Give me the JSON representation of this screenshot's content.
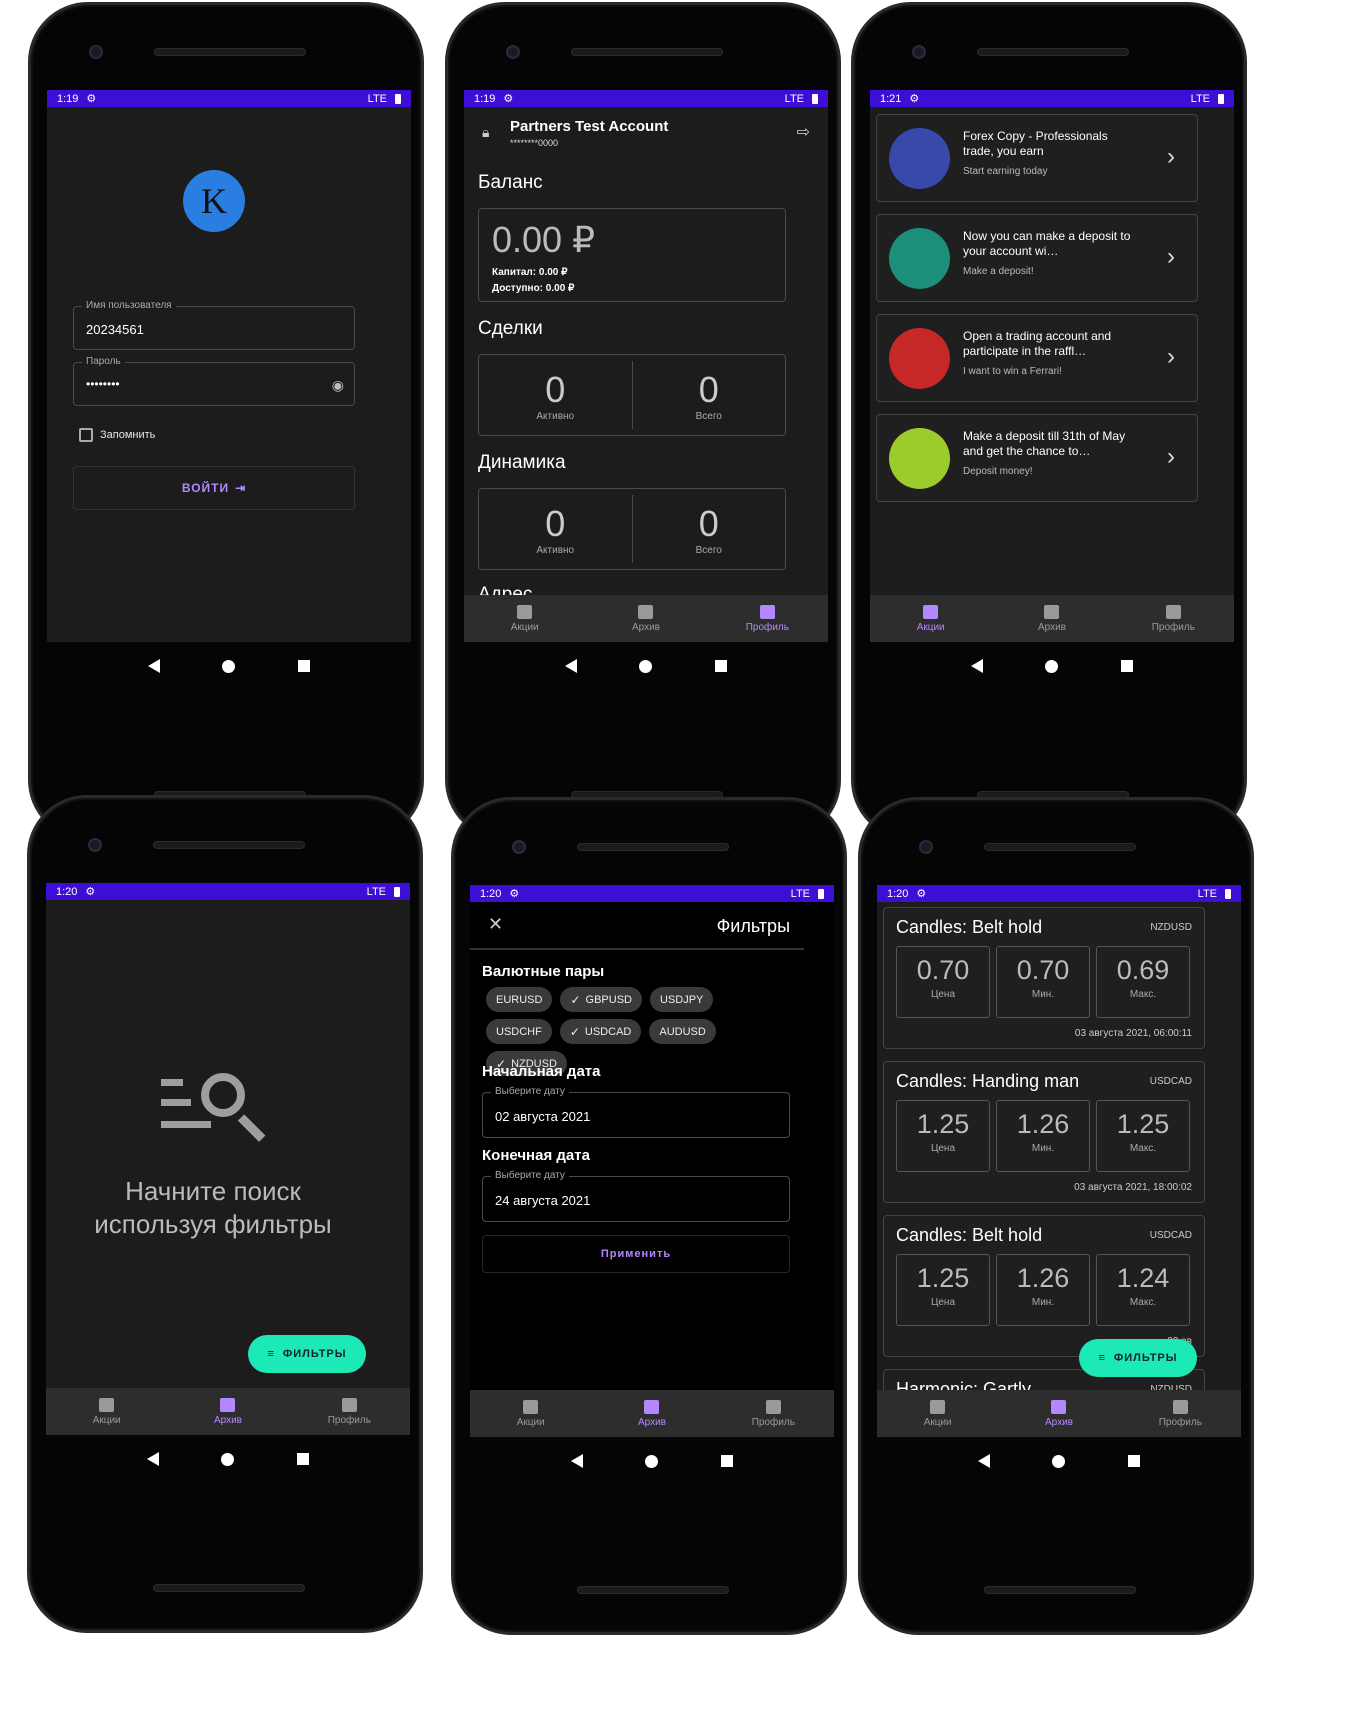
{
  "phones": [
    {
      "status_time": "1:19",
      "status_right": "LTE"
    },
    {
      "status_time": "1:19",
      "status_right": "LTE"
    },
    {
      "status_time": "1:21",
      "status_right": "LTE"
    },
    {
      "status_time": "1:20",
      "status_right": "LTE"
    },
    {
      "status_time": "1:20",
      "status_right": "LTE"
    },
    {
      "status_time": "1:20",
      "status_right": "LTE"
    }
  ],
  "nav": {
    "promo": "Акции",
    "archive": "Архив",
    "profile": "Профиль"
  },
  "login": {
    "avatar_letter": "K",
    "username_label": "Имя пользователя",
    "username_value": "20234561",
    "password_label": "Пароль",
    "password_value": "••••••••",
    "remember_label": "Запомнить",
    "login_button": "ВОЙТИ"
  },
  "profile": {
    "account_name": "Partners Test Account",
    "account_number": "********0000",
    "balance_title": "Баланс",
    "balance_value": "0.00 ₽",
    "capital": "Капитал: 0.00 ₽",
    "available": "Доступно: 0.00 ₽",
    "deals_title": "Сделки",
    "deals_active_value": "0",
    "deals_active_label": "Активно",
    "deals_total_value": "0",
    "deals_total_label": "Всего",
    "dynamics_title": "Динамика",
    "dyn_active_value": "0",
    "dyn_active_label": "Активно",
    "dyn_total_value": "0",
    "dyn_total_label": "Всего",
    "address_title": "Адрес"
  },
  "promos": [
    {
      "title": "Forex Copy - Professionals trade, you earn",
      "subtitle": "Start earning today",
      "color": "#3949ab"
    },
    {
      "title": "Now you can make a deposit to your account wi…",
      "subtitle": "Make a deposit!",
      "color": "#1b8f7a"
    },
    {
      "title": "Open a trading account and participate in the raffl…",
      "subtitle": "I want to win a Ferrari!",
      "color": "#c62828"
    },
    {
      "title": "Make a deposit till 31th of May and get the chance to…",
      "subtitle": "Deposit money!",
      "color": "#9ccc2b"
    }
  ],
  "empty": {
    "message": "Начните поиск используя фильтры",
    "fab": "ФИЛЬТРЫ"
  },
  "filters": {
    "title": "Фильтры",
    "pairs_title": "Валютные пары",
    "pairs": [
      {
        "label": "EURUSD",
        "checked": false
      },
      {
        "label": "GBPUSD",
        "checked": true
      },
      {
        "label": "USDJPY",
        "checked": false
      },
      {
        "label": "USDCHF",
        "checked": false
      },
      {
        "label": "USDCAD",
        "checked": true
      },
      {
        "label": "AUDUSD",
        "checked": false
      },
      {
        "label": "NZDUSD",
        "checked": true
      }
    ],
    "start_title": "Начальная дата",
    "start_label": "Выберите дату",
    "start_value": "02 августа 2021",
    "end_title": "Конечная дата",
    "end_label": "Выберите дату",
    "end_value": "24 августа 2021",
    "apply": "Применить"
  },
  "signals": {
    "fab": "ФИЛЬТРЫ",
    "items": [
      {
        "name": "Candles: Belt hold",
        "pair": "NZDUSD",
        "price": "0.70",
        "min": "0.70",
        "max": "0.69",
        "date": "03 августа 2021, 06:00:11"
      },
      {
        "name": "Candles: Handing man",
        "pair": "USDCAD",
        "price": "1.25",
        "min": "1.26",
        "max": "1.25",
        "date": "03 августа 2021, 18:00:02"
      },
      {
        "name": "Candles: Belt hold",
        "pair": "USDCAD",
        "price": "1.25",
        "min": "1.26",
        "max": "1.24",
        "date": "03 ав"
      },
      {
        "name": "Harmonic: Gartly",
        "pair": "NZDUSD"
      }
    ],
    "price_label": "Цена",
    "min_label": "Мин.",
    "max_label": "Макс."
  }
}
